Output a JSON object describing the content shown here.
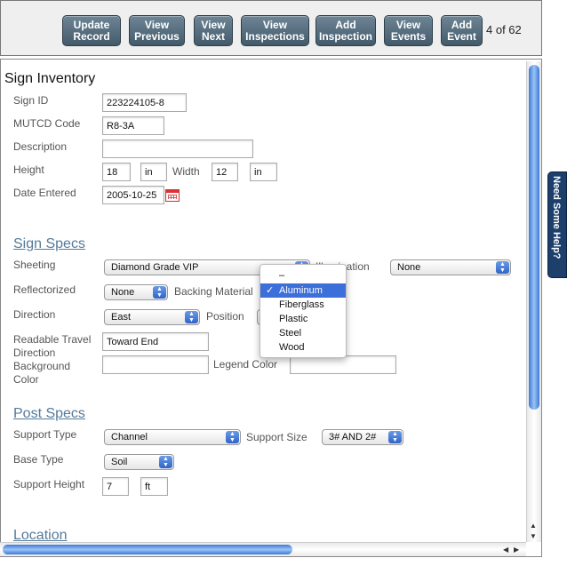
{
  "toolbar": {
    "buttons": [
      {
        "label": "Update\nRecord"
      },
      {
        "label": "View\nPrevious"
      },
      {
        "label": "View\nNext"
      },
      {
        "label": "View\nInspections"
      },
      {
        "label": "Add\nInspection"
      },
      {
        "label": "View\nEvents"
      },
      {
        "label": "Add\nEvent"
      }
    ],
    "counter": "4 of 62"
  },
  "sign_inventory": {
    "title": "Sign Inventory",
    "sign_id_label": "Sign ID",
    "sign_id_value": "223224105-8",
    "mutcd_label": "MUTCD Code",
    "mutcd_value": "R8-3A",
    "description_label": "Description",
    "description_value": "",
    "height_label": "Height",
    "height_value": "18",
    "height_unit": "in",
    "width_label": "Width",
    "width_value": "12",
    "width_unit": "in",
    "date_label": "Date Entered",
    "date_value": "2005-10-25"
  },
  "sign_specs": {
    "heading": "Sign Specs",
    "sheeting_label": "Sheeting",
    "sheeting_value": "Diamond Grade VIP",
    "illumination_label": "Illumination",
    "illumination_value": "None",
    "reflectorized_label": "Reflectorized",
    "reflectorized_value": "None",
    "backing_label": "Backing Material",
    "direction_label": "Direction",
    "direction_value": "East",
    "position_label": "Position",
    "readable_label": "Readable Travel Direction",
    "readable_value": "Toward End",
    "background_label": "Background Color",
    "background_value": "",
    "legend_label": "Legend Color",
    "legend_value": ""
  },
  "backing_menu": {
    "options": [
      "–",
      "Aluminum",
      "Fiberglass",
      "Plastic",
      "Steel",
      "Wood"
    ],
    "selected": "Aluminum",
    "check": "✓"
  },
  "post_specs": {
    "heading": "Post Specs",
    "support_type_label": "Support Type",
    "support_type_value": "Channel",
    "support_size_label": "Support Size",
    "support_size_value": "3# AND 2#",
    "base_type_label": "Base Type",
    "base_type_value": "Soil",
    "support_height_label": "Support Height",
    "support_height_value": "7",
    "support_height_unit": "ft"
  },
  "location": {
    "heading": "Location"
  },
  "help_tab": "Need Some Help?",
  "colors": {
    "button": "#4f6778",
    "heading": "#557a9b",
    "highlight": "#3d6fdb",
    "help_tab": "#1d3f6b"
  }
}
